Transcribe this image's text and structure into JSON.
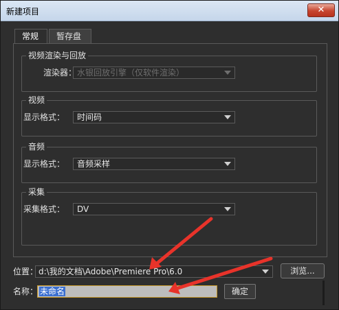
{
  "window": {
    "title": "新建项目",
    "close_symbol": "✕"
  },
  "tabs": [
    {
      "label": "常规"
    },
    {
      "label": "暂存盘"
    }
  ],
  "groups": {
    "video_render": {
      "title": "视频渲染与回放",
      "renderer_label": "渲染器：",
      "renderer_value": "水银回放引擎（仅软件渲染）"
    },
    "video": {
      "title": "视频",
      "format_label": "显示格式：",
      "format_value": "时间码"
    },
    "audio": {
      "title": "音频",
      "format_label": "显示格式：",
      "format_value": "音频采样"
    },
    "capture": {
      "title": "采集",
      "format_label": "采集格式：",
      "format_value": "DV"
    }
  },
  "location": {
    "label": "位置：",
    "value": "d:\\我的文档\\Adobe\\Premiere Pro\\6.0",
    "browse_label": "浏览..."
  },
  "name": {
    "label": "名称：",
    "value": "未命名"
  },
  "ok": {
    "label": "确定"
  },
  "colors": {
    "annotation_arrow": "#e8332a"
  }
}
